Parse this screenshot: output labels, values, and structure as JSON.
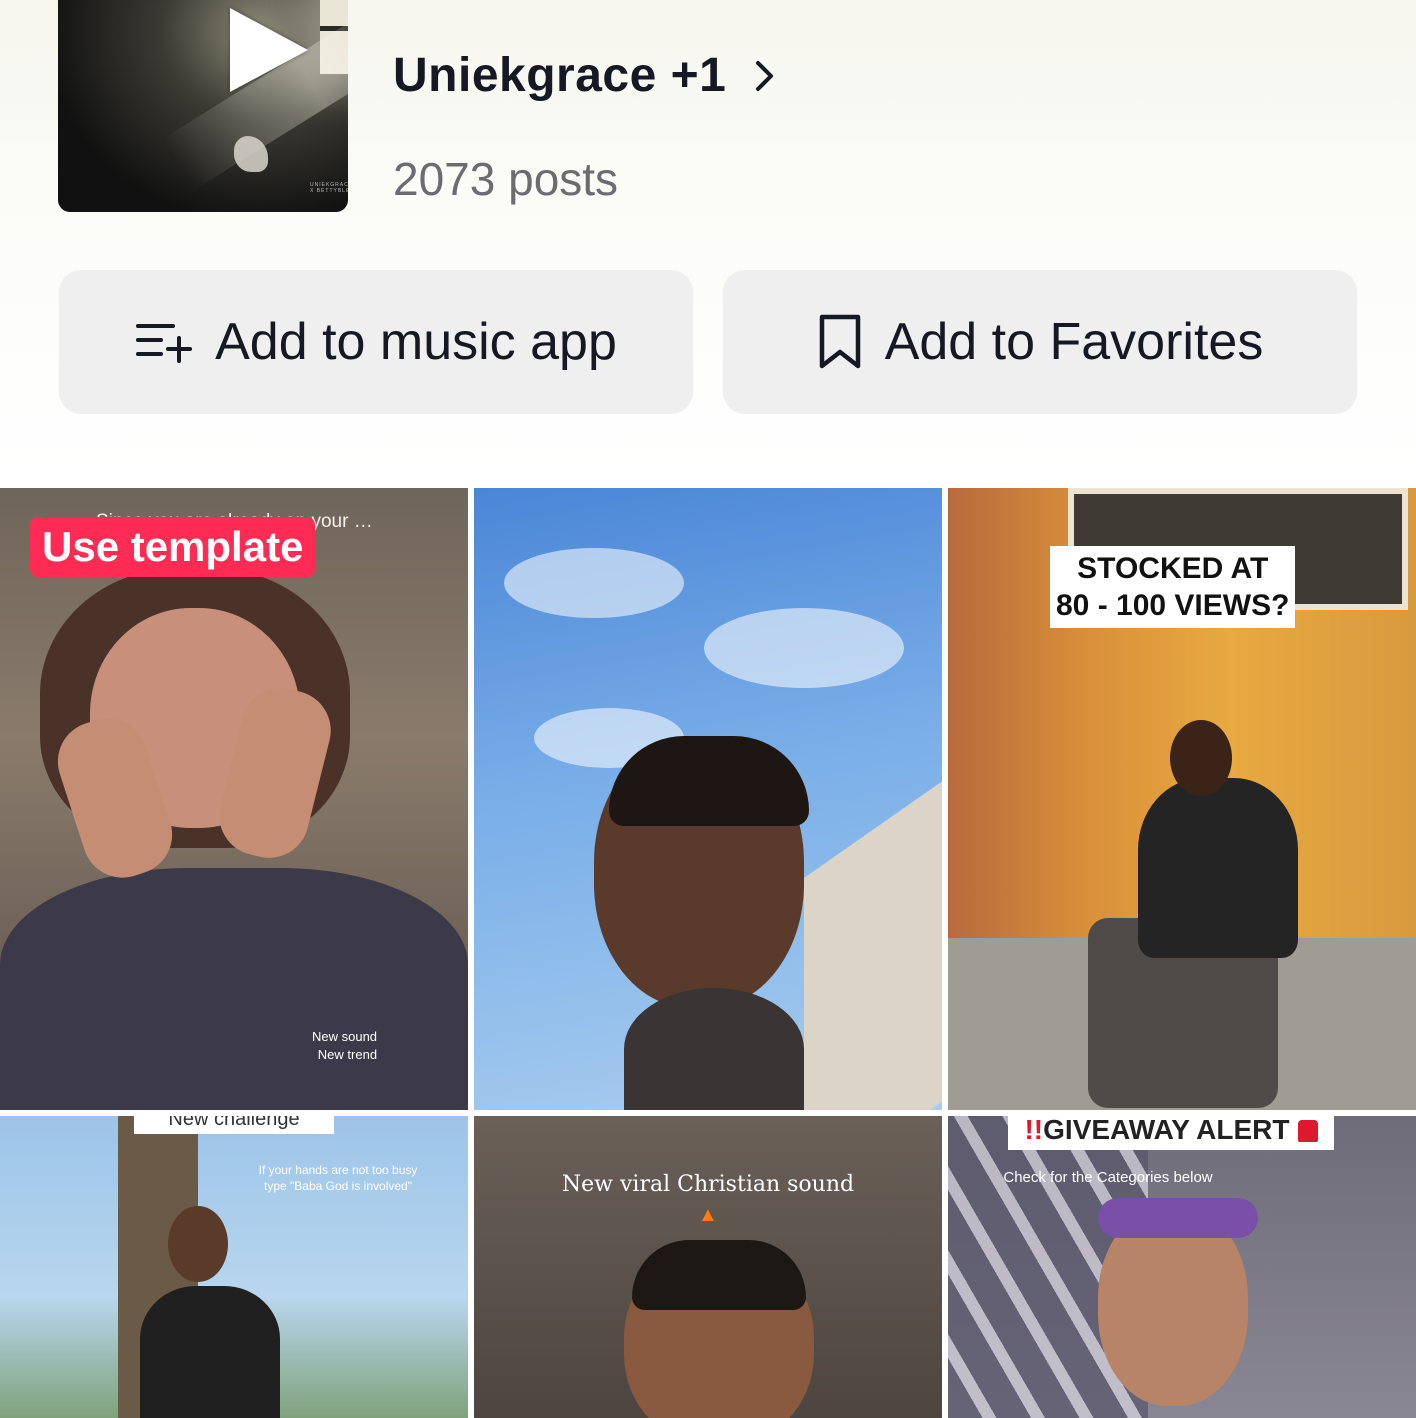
{
  "header": {
    "artist": "Uniekgrace +1",
    "posts": "2073 posts"
  },
  "cover": {
    "small_text": "UNIEKGRACE X BETTYBLE"
  },
  "actions": {
    "add_to_music_app": "Add to music app",
    "add_to_favorites": "Add to Favorites"
  },
  "videos": [
    {
      "badge": "Use template",
      "overlay_text": "Since you are already on your … type God is involved",
      "corner_text_1": "New sound",
      "corner_text_2": "New trend"
    },
    {},
    {
      "overlay_text": "STOCKED AT\n80 - 100 VIEWS?"
    },
    {
      "top_banner": "New challenge",
      "overlay_text": "If your hands are not too busy type \"Baba God is involved\""
    },
    {
      "overlay_text": "New viral Christian sound"
    },
    {
      "overlay_text": "GIVEAWAY ALERT",
      "sub_text": "Check for the Categories below"
    }
  ],
  "colors": {
    "badge": "#fe2c55",
    "button_bg": "#efefef",
    "posts_text": "#6b6b70"
  }
}
